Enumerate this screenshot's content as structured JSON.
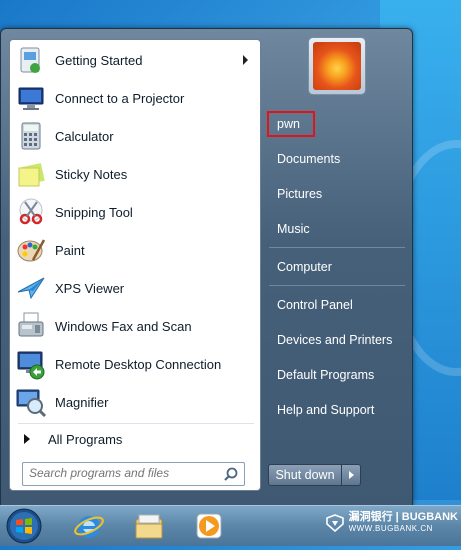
{
  "start_menu": {
    "programs": [
      {
        "label": "Getting Started",
        "icon": "getting-started-icon",
        "has_submenu": true
      },
      {
        "label": "Connect to a Projector",
        "icon": "projector-icon"
      },
      {
        "label": "Calculator",
        "icon": "calculator-icon"
      },
      {
        "label": "Sticky Notes",
        "icon": "sticky-notes-icon"
      },
      {
        "label": "Snipping Tool",
        "icon": "scissors-icon"
      },
      {
        "label": "Paint",
        "icon": "paint-palette-icon"
      },
      {
        "label": "XPS Viewer",
        "icon": "xps-viewer-icon"
      },
      {
        "label": "Windows Fax and Scan",
        "icon": "fax-icon"
      },
      {
        "label": "Remote Desktop Connection",
        "icon": "remote-desktop-icon"
      },
      {
        "label": "Magnifier",
        "icon": "magnifier-icon"
      }
    ],
    "all_programs_label": "All Programs",
    "search": {
      "placeholder": "Search programs and files",
      "value": ""
    },
    "right_pane": {
      "user_name": "pwn",
      "items": [
        "Documents",
        "Pictures",
        "Music",
        "Computer",
        "Control Panel",
        "Devices and Printers",
        "Default Programs",
        "Help and Support"
      ]
    },
    "shutdown_label": "Shut down"
  },
  "taskbar": {
    "apps": [
      "internet-explorer-icon",
      "windows-explorer-icon",
      "media-player-icon"
    ]
  },
  "watermark": {
    "name": "漏洞银行 | BUGBANK",
    "url": "WWW.BUGBANK.CN"
  },
  "colors": {
    "highlight_border": "#e2141a",
    "menu_body": "#46607a"
  }
}
